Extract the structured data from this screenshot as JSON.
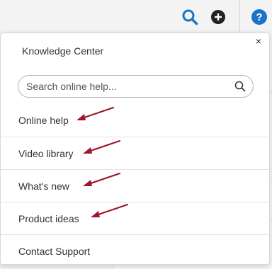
{
  "topbar": {
    "icons": [
      "search-icon",
      "plus-circle-icon",
      "help-circle-icon"
    ],
    "colors": {
      "search": "#1a73c8",
      "plus": "#222222",
      "help": "#1a73c8"
    }
  },
  "panel": {
    "title": "Knowledge Center",
    "close_glyph": "×",
    "search": {
      "placeholder": "Search online help..."
    },
    "items": [
      {
        "label": "Online help"
      },
      {
        "label": "Video library"
      },
      {
        "label": "What's new"
      },
      {
        "label": "Product ideas"
      },
      {
        "label": "Contact Support"
      }
    ],
    "annotation_color": "#a0152a"
  }
}
